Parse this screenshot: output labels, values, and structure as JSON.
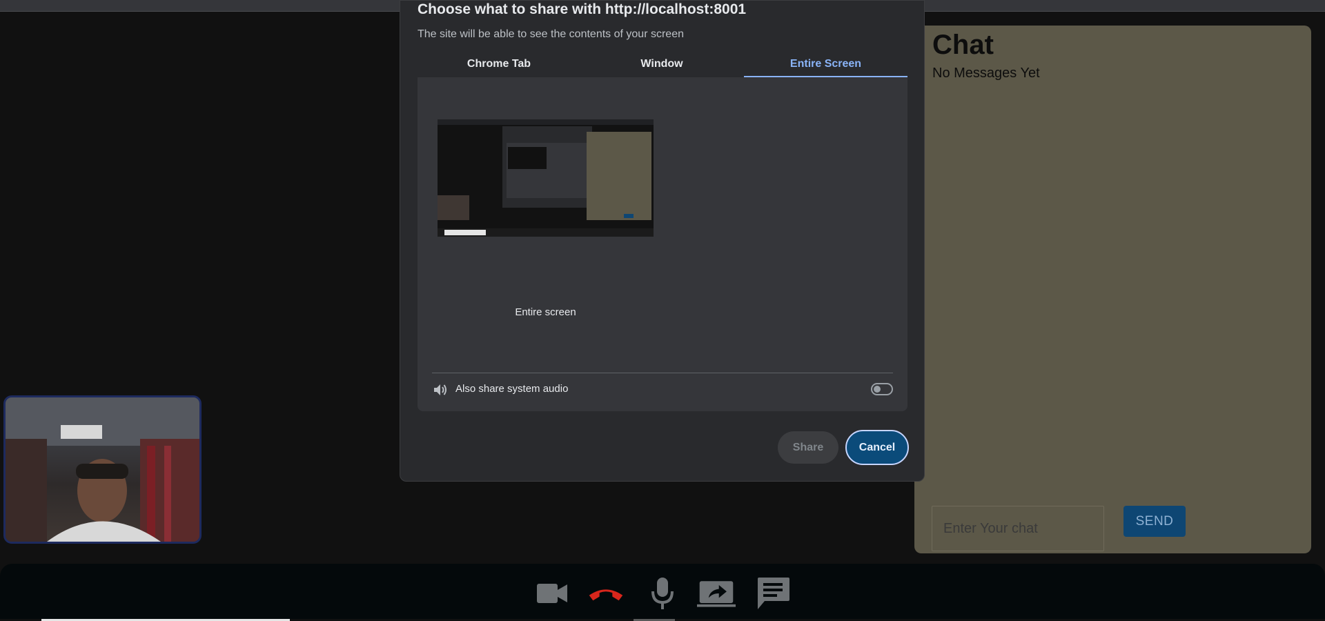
{
  "dialog": {
    "title": "Choose what to share with http://localhost:8001",
    "subtitle": "The site will be able to see the contents of your screen",
    "tabs": [
      "Chrome Tab",
      "Window",
      "Entire Screen"
    ],
    "active_tab": "Entire Screen",
    "source_label": "Entire screen",
    "audio_label": "Also share system audio",
    "audio_toggle_on": false,
    "share_label": "Share",
    "cancel_label": "Cancel"
  },
  "chat": {
    "title": "Chat",
    "empty_text": "No Messages Yet",
    "input_placeholder": "Enter Your chat",
    "send_label": "SEND"
  },
  "controls": [
    "video-camera-icon",
    "end-call-icon",
    "microphone-icon",
    "share-screen-icon",
    "chat-icon"
  ],
  "colors": {
    "dialog_bg": "#292a2d",
    "accent_blue": "#8ab4f8",
    "chat_bg": "#5c5848",
    "send_bg": "#0e4673",
    "end_call_red": "#d9261c",
    "control_icon": "#6f7376"
  }
}
